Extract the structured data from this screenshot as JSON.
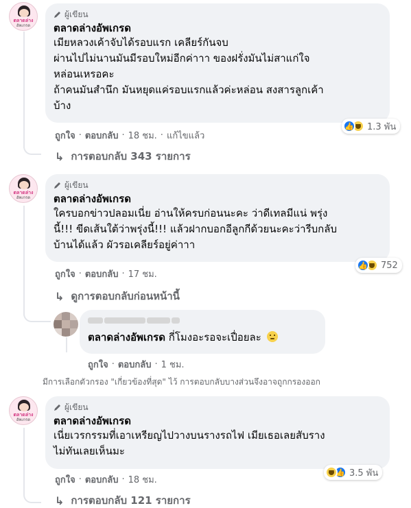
{
  "comments": [
    {
      "badge": "ผู้เขียน",
      "author": "ตลาดล่างอัพเกรด",
      "text": "เมียหลวงเค้าจับได้รอบแรก เคลียร์กันจบ\nผ่านไปไม่นานมันมีรอบใหม่อีกค่าาา ของฝรั่งมันไม่สาแก่ใจ\nหล่อนเหรอคะ\nถ้าคนมันสำนึก มันหยุดแค่รอบแรกแล้วค่ะหล่อน สงสารลูกเค้า\nบ้าง",
      "like": "ถูกใจ",
      "reply": "ตอบกลับ",
      "time": "18 ชม.",
      "edited": "แก้ไขแล้ว",
      "reaction_count": "1.3 พัน",
      "replies_label": "การตอบกลับ 343 รายการ"
    },
    {
      "badge": "ผู้เขียน",
      "author": "ตลาดล่างอัพเกรด",
      "text": "ใครบอกข่าวปลอมเนี่ย อ่านให้ครบก่อนนะคะ ว่าดีเทลมีแน่ พรุ่ง\nนี้!!! ขีดเส้นใต้ว่าพรุ่งนี้!!! แล้วฝากบอกอีลูกกีด้วยนะคะว่ารีบกลับ\nบ้านได้แล้ว ผัวรอเคลียร์อยู่ค่าาา",
      "like": "ถูกใจ",
      "reply": "ตอบกลับ",
      "time": "17 ชม.",
      "reaction_count": "752",
      "previous_label": "ดูการตอบกลับก่อนหน้านี้",
      "nested": {
        "author": "ตลาดล่างอัพเกรด",
        "text": "กี่โมงอะรอจะเปื่อยละ",
        "like": "ถูกใจ",
        "reply": "ตอบกลับ",
        "time": "1 ชม."
      }
    },
    {
      "badge": "ผู้เขียน",
      "author": "ตลาดล่างอัพเกรด",
      "text": "เนี่ยเวรกรรมที่เอาเหรียญไปวางบนรางรถไฟ เมียเธอเลยสับราง\nไม่ทันเลยเห็นมะ",
      "like": "ถูกใจ",
      "reply": "ตอบกลับ",
      "time": "18 ชม.",
      "reaction_count": "3.5 พัน",
      "replies_label": "การตอบกลับ 121 รายการ"
    }
  ],
  "avatar_text": {
    "line1": "ตลาดล่าง",
    "line2": "อัพเกรด"
  },
  "filter_note": "มีการเลือกตัวกรอง \"เกี่ยวข้องที่สุด\" ไว้ การตอบกลับบางส่วนจึงอาจถูกกรองออก",
  "icons": {
    "badge": "pencil-icon",
    "reply_arrow": "reply-arrow-icon",
    "reactions": [
      "like-icon",
      "haha-icon"
    ]
  },
  "colors": {
    "bubble": "#f0f2f5",
    "meta": "#65676b",
    "like": "#1877f2",
    "haha": "#f7d14c"
  }
}
